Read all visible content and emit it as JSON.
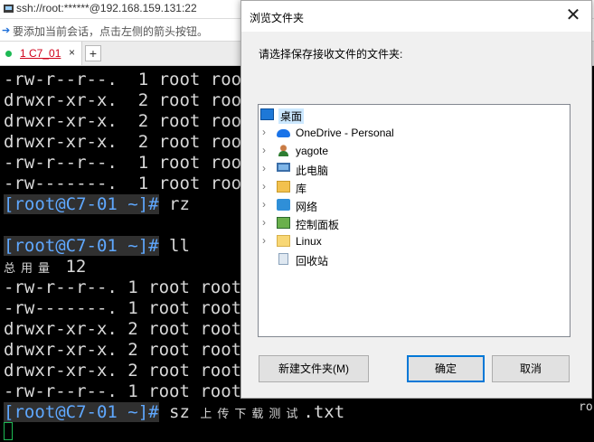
{
  "terminal": {
    "title": "ssh://root:******@192.168.159.131:22",
    "hint": "要添加当前会话，点击左侧的箭头按钮。",
    "tab": {
      "label": "1 C7_01",
      "close": "×"
    },
    "new_tab": "+",
    "lines": [
      {
        "text": "-rw-r--r--.  1 root root"
      },
      {
        "text": "drwxr-xr-x.  2 root root"
      },
      {
        "text": "drwxr-xr-x.  2 root root"
      },
      {
        "text": "drwxr-xr-x.  2 root root"
      },
      {
        "text": "-rw-r--r--.  1 root root"
      },
      {
        "text": "-rw-------.  1 root root"
      },
      {
        "prompt": "[root@C7-01 ~]#",
        "cmd": " rz"
      },
      {
        "text": ""
      },
      {
        "prompt": "[root@C7-01 ~]#",
        "cmd": " ll"
      },
      {
        "cjk": "总用量",
        "text": " 12"
      },
      {
        "text": "-rw-r--r--. 1 root root"
      },
      {
        "text": "-rw-------. 1 root root"
      },
      {
        "text": "drwxr-xr-x. 2 root root"
      },
      {
        "text": "drwxr-xr-x. 2 root root"
      },
      {
        "text": "drwxr-xr-x. 2 root root"
      },
      {
        "text": "-rw-r--r--. 1 root root"
      },
      {
        "prompt": "[root@C7-01 ~]#",
        "cmd": " sz ",
        "cjk": "上传下载测试",
        "tail": ".txt"
      }
    ],
    "right_fragments": [
      "ll",
      "ro"
    ]
  },
  "dialog": {
    "title": "浏览文件夹",
    "close": "✕",
    "prompt": "请选择保存接收文件的文件夹:",
    "tree": [
      {
        "label": "桌面",
        "icon": "desktop-icon",
        "root": true
      },
      {
        "label": "OneDrive - Personal",
        "icon": "cloud-icon"
      },
      {
        "label": "yagote",
        "icon": "user-icon"
      },
      {
        "label": "此电脑",
        "icon": "computer-icon"
      },
      {
        "label": "库",
        "icon": "library-icon"
      },
      {
        "label": "网络",
        "icon": "network-icon"
      },
      {
        "label": "控制面板",
        "icon": "control-panel-icon"
      },
      {
        "label": "Linux",
        "icon": "folder-icon"
      },
      {
        "label": "回收站",
        "icon": "recycle-bin-icon",
        "no_expander": true
      }
    ],
    "buttons": {
      "new_folder": "新建文件夹(M)",
      "ok": "确定",
      "cancel": "取消"
    }
  }
}
